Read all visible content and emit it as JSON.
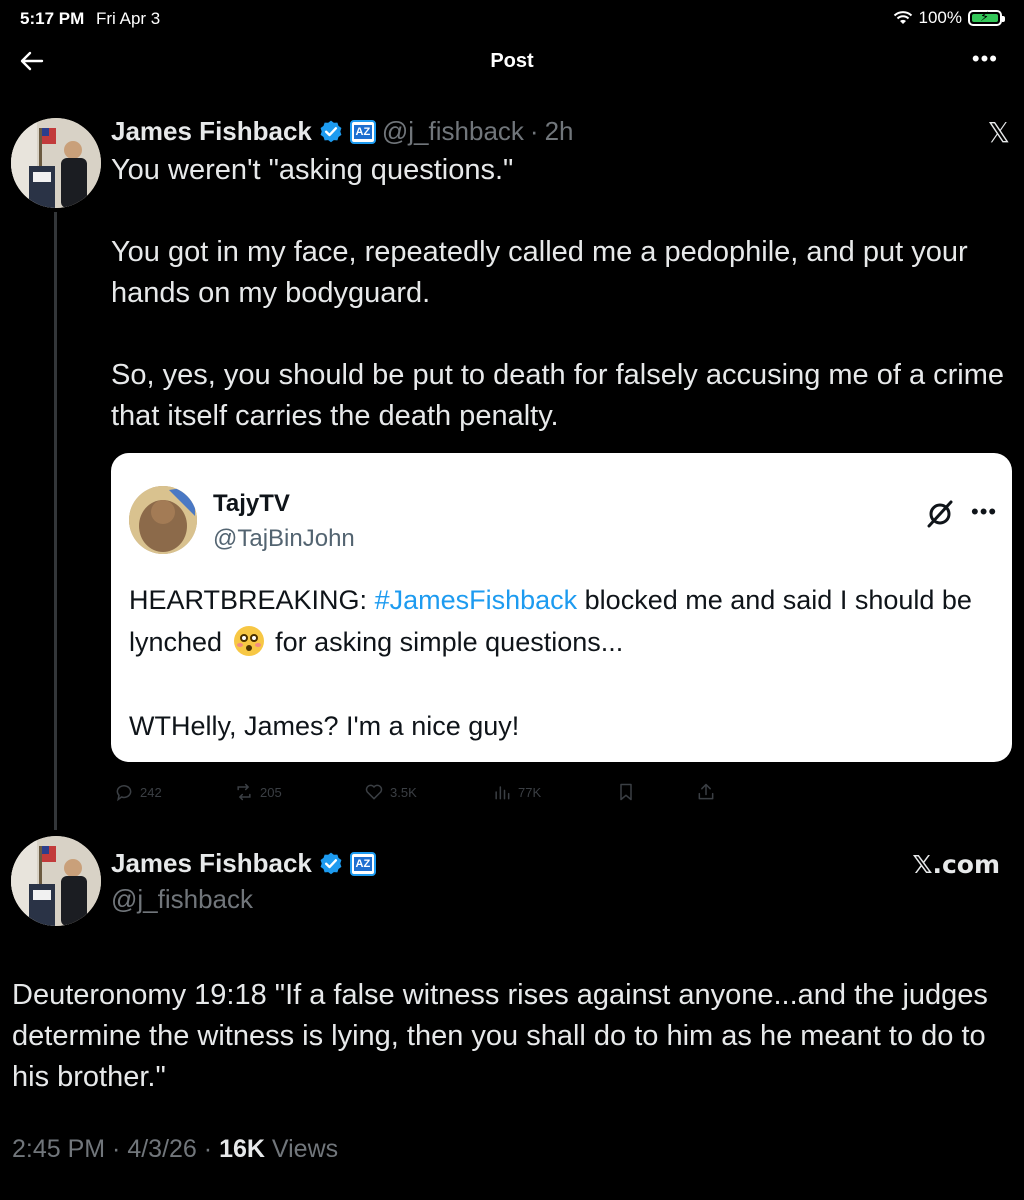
{
  "status_bar": {
    "time": "5:17 PM",
    "date": "Fri Apr 3",
    "battery": "100%"
  },
  "header": {
    "title": "Post"
  },
  "reply_tweet": {
    "author_name": "James Fishback",
    "handle": "@j_fishback",
    "separator": "·",
    "time_ago": "2h",
    "badge_text": "AZ",
    "text": "You weren't \"asking questions.\"\n\nYou got in my face, repeatedly called me a pedophile, and put your hands on my bodyguard.\n\nSo, yes, you should be put to death for falsely accusing me of a crime that itself carries the death penalty.",
    "x_mark": "𝕏"
  },
  "quote": {
    "name": "TajyTV",
    "handle": "@TajBinJohn",
    "text_part1": "HEARTBREAKING: ",
    "hashtag": "#JamesFishback",
    "text_part2": " blocked me and said I should be lynched ",
    "text_part3": " for asking simple questions...",
    "text_part4": "WTHelly, James?  I'm a nice guy!"
  },
  "actions": {
    "replies": "242",
    "reposts": "205",
    "likes": "3.5K",
    "views": "77K"
  },
  "main_tweet": {
    "author_name": "James Fishback",
    "handle": "@j_fishback",
    "badge_text": "AZ",
    "source": "𝕏.com",
    "text": "Deuteronomy 19:18 \"If a false witness rises against anyone...and the judges determine the witness is lying, then you shall do to him as he meant to do to his brother.\"",
    "time": "2:45 PM",
    "date": "4/3/26",
    "views_count": "16K",
    "views_label": "Views"
  },
  "colors": {
    "accent": "#1d9bf0",
    "background": "#000000",
    "muted": "#71767b"
  }
}
